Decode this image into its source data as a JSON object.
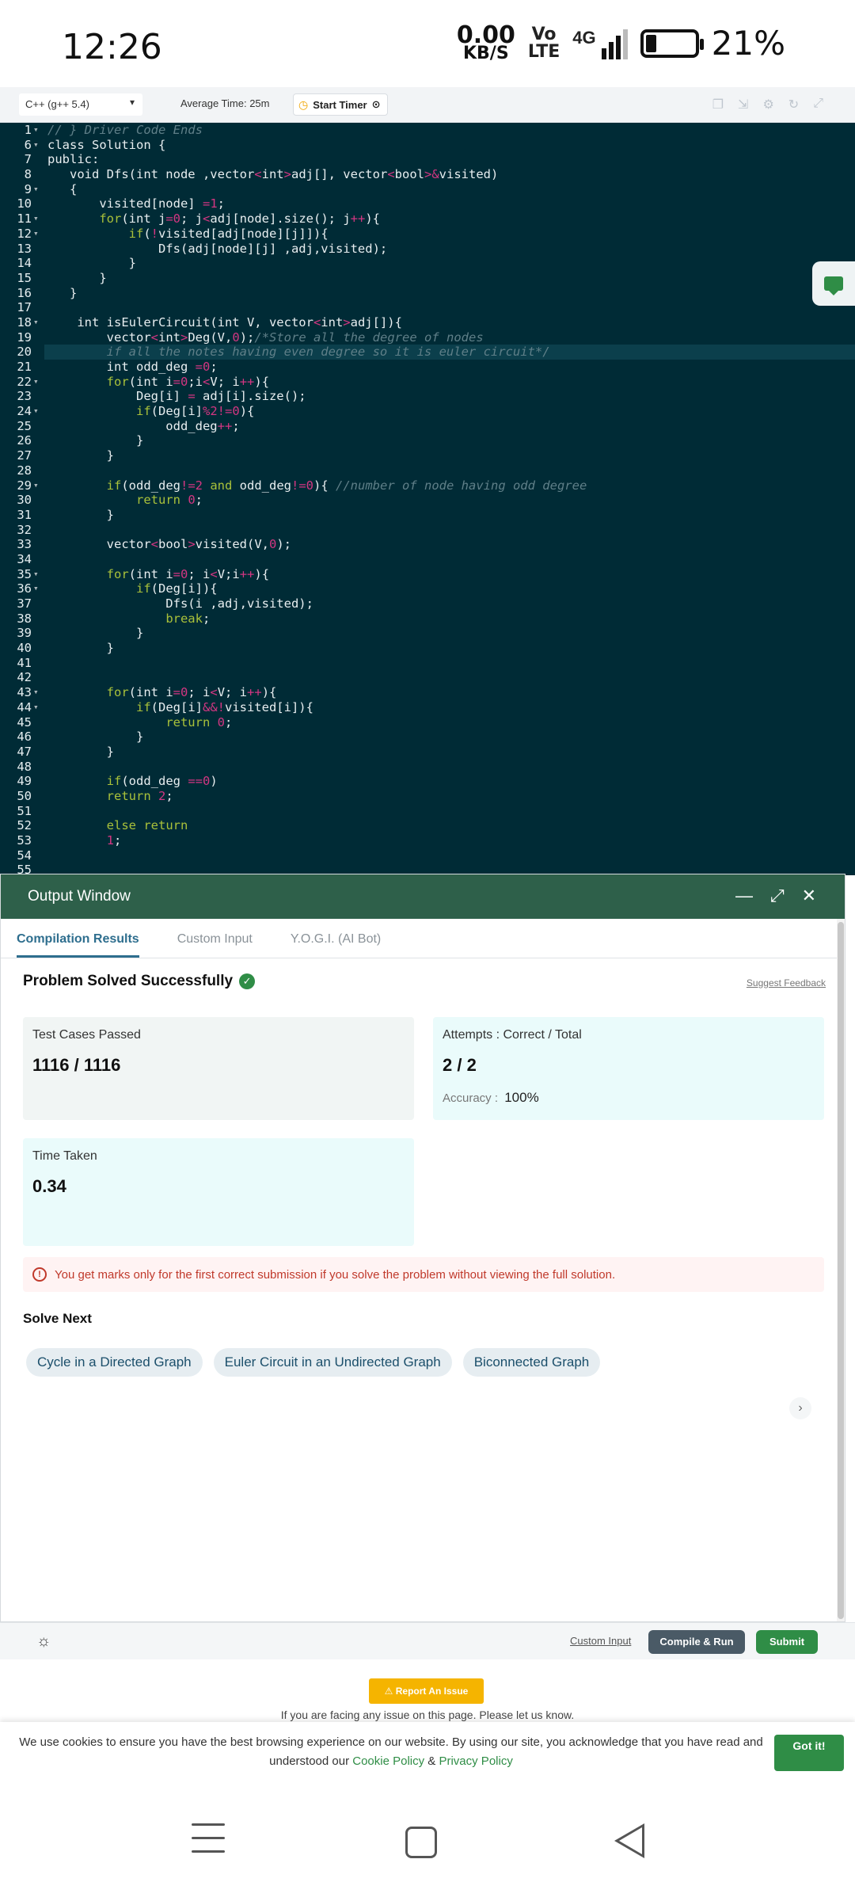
{
  "status": {
    "time": "12:26",
    "net_value": "0.00",
    "net_unit": "KB/S",
    "volte_top": "Vo",
    "volte_bottom": "LTE",
    "network": "4G",
    "battery": "21%",
    "battery_level": 0.21
  },
  "toolbar": {
    "language": "C++ (g++ 5.4)",
    "avg_time": "Average Time: 25m",
    "start_timer": "Start Timer"
  },
  "editor": {
    "active_line": 20,
    "lines": [
      {
        "n": "1",
        "fold": true,
        "html": "<span class=\"cm\">// } Driver Code Ends</span>"
      },
      {
        "n": "6",
        "fold": true,
        "html": "class Solution {"
      },
      {
        "n": "7",
        "fold": false,
        "html": "public:"
      },
      {
        "n": "8",
        "fold": false,
        "html": "   void Dfs(int node ,vector<span class=\"op\">&lt;</span>int<span class=\"op\">&gt;</span>adj[], vector<span class=\"op\">&lt;</span>bool<span class=\"op\">&gt;&amp;</span>visited)"
      },
      {
        "n": "9",
        "fold": true,
        "html": "   {"
      },
      {
        "n": "10",
        "fold": false,
        "html": "       visited[node] <span class=\"op\">=</span><span class=\"num\">1</span>;"
      },
      {
        "n": "11",
        "fold": true,
        "html": "       <span class=\"kw\">for</span>(int j<span class=\"op\">=</span><span class=\"num\">0</span>; j<span class=\"op\">&lt;</span>adj[node].size(); j<span class=\"op\">++</span>){"
      },
      {
        "n": "12",
        "fold": true,
        "html": "           <span class=\"kw\">if</span>(<span class=\"op\">!</span>visited[adj[node][j]]){"
      },
      {
        "n": "13",
        "fold": false,
        "html": "               Dfs(adj[node][j] ,adj,visited);"
      },
      {
        "n": "14",
        "fold": false,
        "html": "           }"
      },
      {
        "n": "15",
        "fold": false,
        "html": "       }"
      },
      {
        "n": "16",
        "fold": false,
        "html": "   }"
      },
      {
        "n": "17",
        "fold": false,
        "html": ""
      },
      {
        "n": "18",
        "fold": true,
        "html": "    int isEulerCircuit(int V, vector<span class=\"op\">&lt;</span>int<span class=\"op\">&gt;</span>adj[]){"
      },
      {
        "n": "19",
        "fold": false,
        "html": "        vector<span class=\"op\">&lt;</span>int<span class=\"op\">&gt;</span>Deg(V,<span class=\"num\">0</span>);<span class=\"cm\">/*Store all the degree of nodes</span>"
      },
      {
        "n": "20",
        "fold": false,
        "html": "<span class=\"cm\">        if all the notes having even degree so it is euler circuit*/</span>"
      },
      {
        "n": "21",
        "fold": false,
        "html": "        int odd_deg <span class=\"op\">=</span><span class=\"num\">0</span>;"
      },
      {
        "n": "22",
        "fold": true,
        "html": "        <span class=\"kw\">for</span>(int i<span class=\"op\">=</span><span class=\"num\">0</span>;i<span class=\"op\">&lt;</span>V; i<span class=\"op\">++</span>){"
      },
      {
        "n": "23",
        "fold": false,
        "html": "            Deg[i] <span class=\"op\">=</span> adj[i].size();"
      },
      {
        "n": "24",
        "fold": true,
        "html": "            <span class=\"kw\">if</span>(Deg[i]<span class=\"op\">%</span><span class=\"num\">2</span><span class=\"op\">!=</span><span class=\"num\">0</span>){"
      },
      {
        "n": "25",
        "fold": false,
        "html": "                odd_deg<span class=\"op\">++</span>;"
      },
      {
        "n": "26",
        "fold": false,
        "html": "            }"
      },
      {
        "n": "27",
        "fold": false,
        "html": "        }"
      },
      {
        "n": "28",
        "fold": false,
        "html": ""
      },
      {
        "n": "29",
        "fold": true,
        "html": "        <span class=\"kw\">if</span>(odd_deg<span class=\"op\">!=</span><span class=\"num\">2</span> <span class=\"kw\">and</span> odd_deg<span class=\"op\">!=</span><span class=\"num\">0</span>){ <span class=\"cm\">//number of node having odd degree</span>"
      },
      {
        "n": "30",
        "fold": false,
        "html": "            <span class=\"kw\">return</span> <span class=\"num\">0</span>;"
      },
      {
        "n": "31",
        "fold": false,
        "html": "        }"
      },
      {
        "n": "32",
        "fold": false,
        "html": ""
      },
      {
        "n": "33",
        "fold": false,
        "html": "        vector<span class=\"op\">&lt;</span>bool<span class=\"op\">&gt;</span>visited(V,<span class=\"num\">0</span>);"
      },
      {
        "n": "34",
        "fold": false,
        "html": ""
      },
      {
        "n": "35",
        "fold": true,
        "html": "        <span class=\"kw\">for</span>(int i<span class=\"op\">=</span><span class=\"num\">0</span>; i<span class=\"op\">&lt;</span>V;i<span class=\"op\">++</span>){"
      },
      {
        "n": "36",
        "fold": true,
        "html": "            <span class=\"kw\">if</span>(Deg[i]){"
      },
      {
        "n": "37",
        "fold": false,
        "html": "                Dfs(i ,adj,visited);"
      },
      {
        "n": "38",
        "fold": false,
        "html": "                <span class=\"kw\">break</span>;"
      },
      {
        "n": "39",
        "fold": false,
        "html": "            }"
      },
      {
        "n": "40",
        "fold": false,
        "html": "        }"
      },
      {
        "n": "41",
        "fold": false,
        "html": ""
      },
      {
        "n": "42",
        "fold": false,
        "html": ""
      },
      {
        "n": "43",
        "fold": true,
        "html": "        <span class=\"kw\">for</span>(int i<span class=\"op\">=</span><span class=\"num\">0</span>; i<span class=\"op\">&lt;</span>V; i<span class=\"op\">++</span>){"
      },
      {
        "n": "44",
        "fold": true,
        "html": "            <span class=\"kw\">if</span>(Deg[i]<span class=\"op\">&amp;&amp;!</span>visited[i]){"
      },
      {
        "n": "45",
        "fold": false,
        "html": "                <span class=\"kw\">return</span> <span class=\"num\">0</span>;"
      },
      {
        "n": "46",
        "fold": false,
        "html": "            }"
      },
      {
        "n": "47",
        "fold": false,
        "html": "        }"
      },
      {
        "n": "48",
        "fold": false,
        "html": ""
      },
      {
        "n": "49",
        "fold": false,
        "html": "        <span class=\"kw\">if</span>(odd_deg <span class=\"op\">==</span><span class=\"num\">0</span>)"
      },
      {
        "n": "50",
        "fold": false,
        "html": "        <span class=\"kw\">return</span> <span class=\"num\">2</span>;"
      },
      {
        "n": "51",
        "fold": false,
        "html": ""
      },
      {
        "n": "52",
        "fold": false,
        "html": "        <span class=\"kw\">else</span> <span class=\"kw\">return</span>"
      },
      {
        "n": "53",
        "fold": false,
        "html": "        <span class=\"num\">1</span>;"
      },
      {
        "n": "54",
        "fold": false,
        "html": ""
      },
      {
        "n": "55",
        "fold": false,
        "html": ""
      }
    ]
  },
  "output": {
    "title": "Output Window",
    "tabs": [
      "Compilation Results",
      "Custom Input",
      "Y.O.G.I. (AI Bot)"
    ],
    "active_tab": 0,
    "status": "Problem Solved Successfully",
    "suggest_feedback": "Suggest Feedback",
    "test_cases_label": "Test Cases Passed",
    "test_cases_value": "1116 / 1116",
    "attempts_label": "Attempts : Correct / Total",
    "attempts_value": "2 / 2",
    "accuracy_label": "Accuracy :",
    "accuracy_value": "100%",
    "time_label": "Time Taken",
    "time_value": "0.34",
    "warning": "You get marks only for the first correct submission if you solve the problem without viewing the full solution.",
    "solve_next_title": "Solve Next",
    "solve_next": [
      "Cycle in a Directed Graph",
      "Euler Circuit in an Undirected Graph",
      "Biconnected Graph"
    ]
  },
  "actions": {
    "custom_input": "Custom Input",
    "compile_run": "Compile & Run",
    "submit": "Submit"
  },
  "report": {
    "button": "Report An Issue",
    "text": "If you are facing any issue on this page. Please let us know."
  },
  "cookie": {
    "text_before": "We use cookies to ensure you have the best browsing experience on our website. By using our site, you acknowledge that you have read and understood our ",
    "cookie_policy": "Cookie Policy",
    "amp": " & ",
    "privacy_policy": "Privacy Policy",
    "got_it": "Got it!"
  },
  "colors": {
    "editor_bg": "#002b36",
    "output_header": "#2e604a",
    "accent_green": "#2f8d46"
  }
}
